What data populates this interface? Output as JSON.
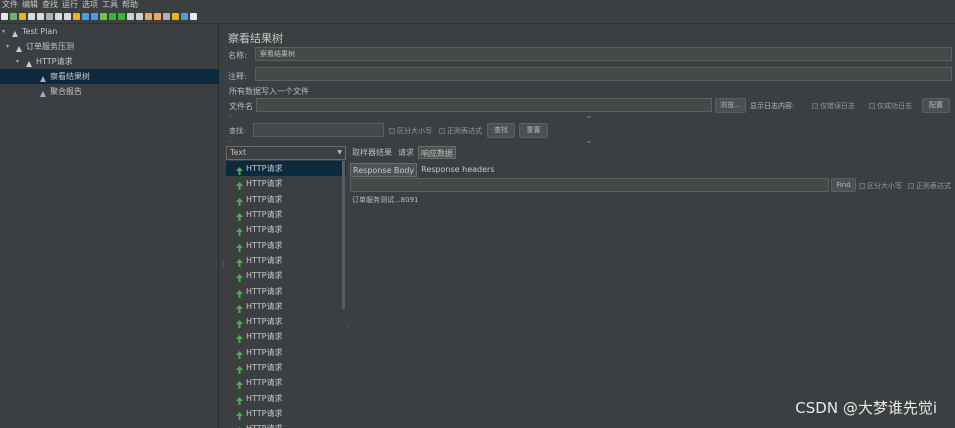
{
  "menu": [
    "文件",
    "编辑",
    "查找",
    "运行",
    "选项",
    "工具",
    "帮助"
  ],
  "toolbar_icons": [
    {
      "name": "new-icon",
      "color": "#e8e8e8"
    },
    {
      "name": "templates-icon",
      "color": "#6fb36f"
    },
    {
      "name": "open-icon",
      "color": "#e6b422"
    },
    {
      "name": "close-icon",
      "color": "#d9d9d9"
    },
    {
      "name": "save-icon",
      "color": "#d9d9d9"
    },
    {
      "name": "save-as-icon",
      "color": "#b0b0b0"
    },
    {
      "name": "cut-icon",
      "color": "#d9d9d9"
    },
    {
      "name": "copy-icon",
      "color": "#d9d9d9"
    },
    {
      "name": "paste-icon",
      "color": "#e6b422"
    },
    {
      "name": "expand-icon",
      "color": "#4a9fd8"
    },
    {
      "name": "collapse-icon",
      "color": "#4a9fd8"
    },
    {
      "name": "toggle-icon",
      "color": "#7bbf4a"
    },
    {
      "name": "start-icon",
      "color": "#35b535"
    },
    {
      "name": "start-no-pause-icon",
      "color": "#35b535"
    },
    {
      "name": "stop-icon",
      "color": "#cfcfcf"
    },
    {
      "name": "shutdown-icon",
      "color": "#cfcfcf"
    },
    {
      "name": "clear-icon",
      "color": "#e0a96d"
    },
    {
      "name": "clear-all-icon",
      "color": "#e0a96d"
    },
    {
      "name": "search-icon",
      "color": "#b0b0b0"
    },
    {
      "name": "reset-search-icon",
      "color": "#e6b422"
    },
    {
      "name": "function-helper-icon",
      "color": "#4a9fd8"
    },
    {
      "name": "help-icon",
      "color": "#e8e8e8"
    }
  ],
  "tree": [
    {
      "label": "Test Plan",
      "icon": "test-plan-icon",
      "color": "#c8c8c8",
      "level": 0,
      "twisty": "▾"
    },
    {
      "label": "订单服务压测",
      "icon": "thread-group-icon",
      "color": "#cccccc",
      "level": 1,
      "twisty": "▾"
    },
    {
      "label": "HTTP请求",
      "icon": "sampler-icon",
      "color": "#d0d0d0",
      "level": 2,
      "twisty": "▾"
    },
    {
      "label": "察看结果树",
      "icon": "listener-icon",
      "color": "#b39ddb",
      "level": 3,
      "twisty": "",
      "selected": true
    },
    {
      "label": "聚合报告",
      "icon": "listener-icon",
      "color": "#b39ddb",
      "level": 3,
      "twisty": ""
    }
  ],
  "panel": {
    "title": "察看结果树",
    "name_label": "名称:",
    "name_value": "察看结果树",
    "comment_label": "注释:",
    "comment_value": "",
    "write_all_label": "所有数据写入一个文件",
    "filename_label": "文件名",
    "filename_value": "",
    "browse_label": "浏览...",
    "log_display_label": "显示日志内容:",
    "errors_only_label": "仅错误日志",
    "success_only_label": "仅成功日志",
    "configure_label": "配置",
    "search_label": "查找:",
    "search_value": "",
    "case_sensitive_label": "区分大小写",
    "regex_label": "正则表达式",
    "find_label": "查找",
    "reset_label": "重置"
  },
  "renderer": {
    "selected": "Text"
  },
  "results": {
    "label": "HTTP请求",
    "status_color": "#4caf50",
    "items": [
      "HTTP请求",
      "HTTP请求",
      "HTTP请求",
      "HTTP请求",
      "HTTP请求",
      "HTTP请求",
      "HTTP请求",
      "HTTP请求",
      "HTTP请求",
      "HTTP请求",
      "HTTP请求",
      "HTTP请求",
      "HTTP请求",
      "HTTP请求",
      "HTTP请求",
      "HTTP请求",
      "HTTP请求",
      "HTTP请求"
    ]
  },
  "detail": {
    "tabs": [
      "取样器结果",
      "请求",
      "响应数据"
    ],
    "active_tab": 2,
    "subtabs": [
      "Response Body",
      "Response headers"
    ],
    "active_subtab": 0,
    "find_value": "",
    "find_label": "Find",
    "case_sensitive_label": "区分大小写",
    "regex_label": "正则表达式",
    "body_text": "订单服务测试...8091"
  },
  "watermark": "CSDN @大梦谁先觉i"
}
